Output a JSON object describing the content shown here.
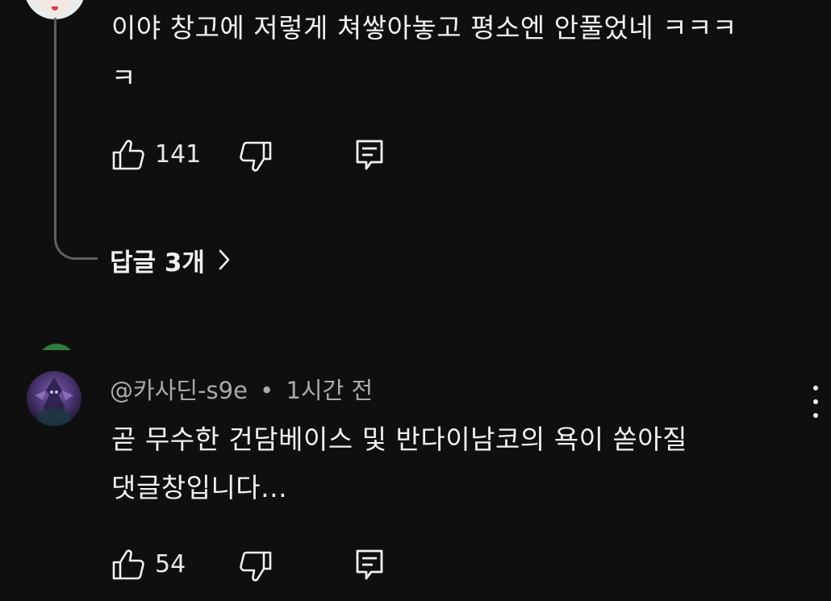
{
  "comment1": {
    "text_line1": "이야 창고에 저렇게 쳐쌓아놓고 평소엔 안풀었네 ㅋㅋㅋ",
    "text_line2": "ㅋ",
    "likes": "141"
  },
  "replies": {
    "label": "답글 3개"
  },
  "comment2": {
    "author": "@카사딘-s9e",
    "separator": "•",
    "time": "1시간 전",
    "text_line1": "곧 무수한 건담베이스 및 반다이남코의 욕이 쏟아질",
    "text_line2": "댓글창입니다...",
    "likes": "54"
  },
  "icons": {
    "like": "thumbs-up-icon",
    "dislike": "thumbs-down-icon",
    "reply": "comment-reply-icon",
    "more": "more-vertical-icon",
    "chevron": "chevron-right-icon"
  },
  "colors": {
    "background": "#0f0f0f",
    "text": "#f1f1f1",
    "meta": "#aaaaaa",
    "thread_line": "#5f5f5f"
  }
}
